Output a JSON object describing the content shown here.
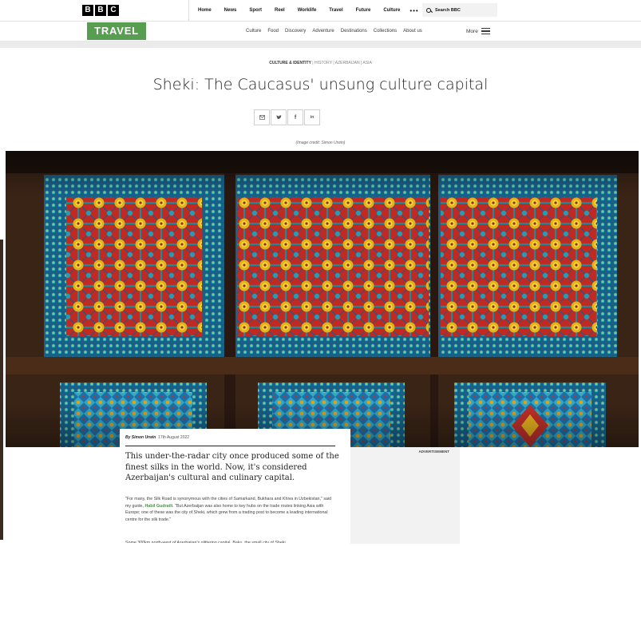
{
  "brand": {
    "letters": [
      "B",
      "B",
      "C"
    ]
  },
  "top_nav": {
    "items": [
      "Home",
      "News",
      "Sport",
      "Reel",
      "Worklife",
      "Travel",
      "Future",
      "Culture"
    ],
    "more": "•••",
    "search_label": "Search BBC"
  },
  "section": {
    "logo": "TRAVEL",
    "nav": [
      "Culture",
      "Food",
      "Discovery",
      "Adventure",
      "Destinations",
      "Collections",
      "About us"
    ],
    "more_label": "More"
  },
  "article": {
    "kicker_main": "CULTURE & IDENTITY",
    "kicker_tags": "| HISTORY | AZERBAIJAN | ASIA",
    "headline": "Sheki: The Caucasus' unsung culture capital",
    "share": [
      {
        "icon": "email-icon",
        "glyph": "✉"
      },
      {
        "icon": "twitter-icon",
        "glyph": "🐦"
      },
      {
        "icon": "facebook-icon",
        "glyph": "f"
      },
      {
        "icon": "linkedin-icon",
        "glyph": "in"
      }
    ],
    "image_credit": "(Image credit: Simon Urwin)",
    "byline_author": "By Simon Urwin",
    "byline_date": "17th August 2022",
    "standfirst": "This under-the-radar city once produced some of the finest silks in the world. Now, it's considered Azerbaijan's cultural and culinary capital.",
    "body_p1_a": "\"For many, the Silk Road is synonymous with the cities of Samarkand, Bukhara and Khiva in Uzbekistan,\" said my guide, ",
    "body_p1_link": "Habil Gudratli",
    "body_p1_b": ". \"But Azerbaijan was also home to key hubs on the trade routes linking Asia with Europe; one of these was the city of Sheki, which grew from a trading post to become a leading international centre for the silk trade.\"",
    "body_p2": "Some 300km north-west of Azerbaijan's glittering capital, Baku, the small city of Sheki"
  },
  "advert": {
    "label": "ADVERTISEMENT"
  }
}
